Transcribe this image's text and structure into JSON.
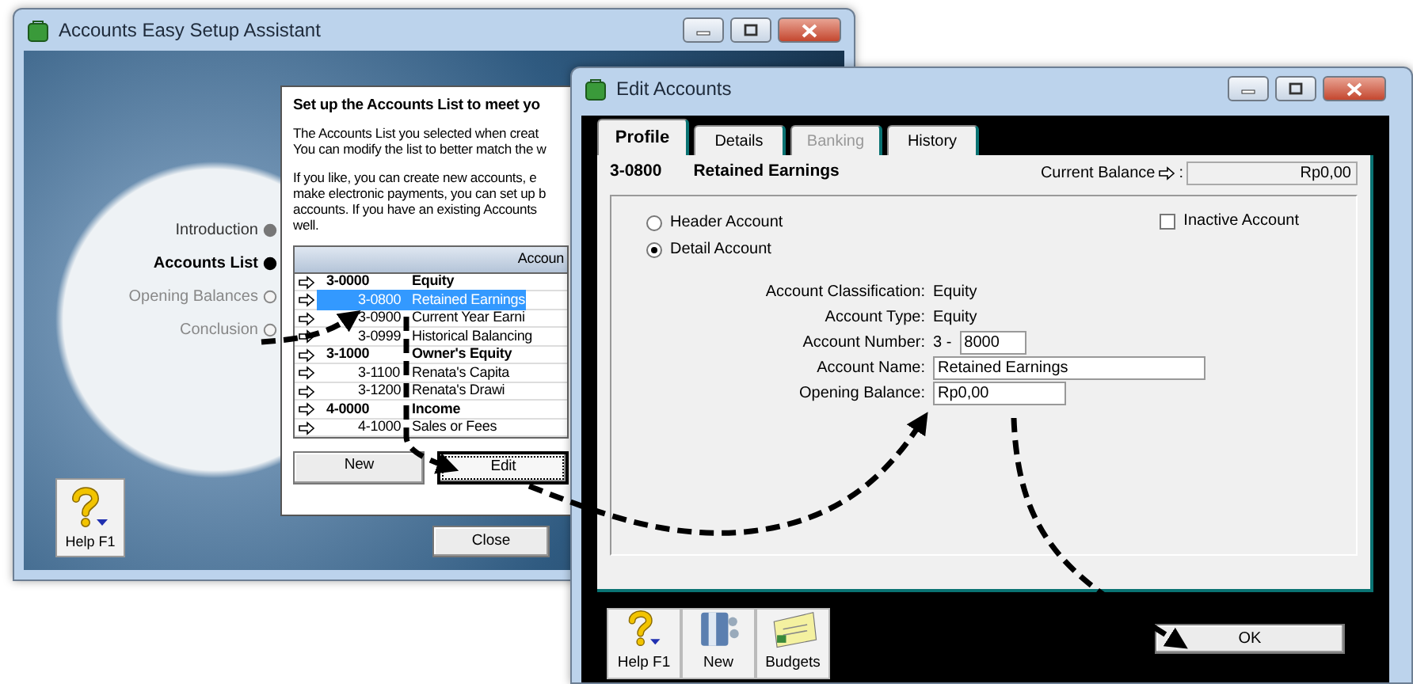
{
  "setup_window": {
    "title": "Accounts Easy Setup Assistant",
    "steps": [
      {
        "label": "Introduction",
        "selected": false,
        "done": true
      },
      {
        "label": "Accounts List",
        "selected": true
      },
      {
        "label": "Opening Balances",
        "selected": false,
        "done": false
      },
      {
        "label": "Conclusion",
        "selected": false,
        "done": false
      }
    ],
    "dialog": {
      "heading": "Set up the Accounts List to meet yo",
      "paragraphs": [
        [
          "The Accounts List you selected when creat",
          "You can modify the list to better match the w"
        ],
        [
          "If you like, you can create new accounts, e",
          "make electronic payments, you can set up b",
          "accounts. If you have an existing Accounts",
          "well."
        ]
      ],
      "table": {
        "columns": [
          "Accoun"
        ],
        "rows": [
          {
            "number": "3-0000",
            "name": "Equity",
            "kind": "header",
            "selected": false
          },
          {
            "number": "3-0800",
            "name": "Retained Earnings",
            "kind": "detail",
            "selected": true
          },
          {
            "number": "3-0900",
            "name": "Current Year Earni",
            "kind": "detail",
            "selected": false
          },
          {
            "number": "3-0999",
            "name": "Historical Balancing",
            "kind": "detail",
            "selected": false
          },
          {
            "number": "3-1000",
            "name": "Owner's Equity",
            "kind": "header",
            "selected": false
          },
          {
            "number": "3-1100",
            "name": "Renata's Capita",
            "kind": "detail",
            "selected": false
          },
          {
            "number": "3-1200",
            "name": "Renata's Drawi",
            "kind": "detail",
            "selected": false
          },
          {
            "number": "4-0000",
            "name": "Income",
            "kind": "header",
            "selected": false
          },
          {
            "number": "4-1000",
            "name": "Sales or Fees",
            "kind": "detail",
            "selected": false
          }
        ]
      },
      "buttons": [
        {
          "label": "New",
          "focused": false
        },
        {
          "label": "Edit",
          "focused": true
        }
      ]
    },
    "help_button": {
      "label": "Help F1"
    },
    "close_button": {
      "label": "Close"
    }
  },
  "edit_window": {
    "title": "Edit Accounts",
    "tabs": [
      {
        "label": "Profile",
        "selected": true,
        "disabled": false
      },
      {
        "label": "Details",
        "selected": false,
        "disabled": false
      },
      {
        "label": "Banking",
        "selected": false,
        "disabled": true
      },
      {
        "label": "History",
        "selected": false,
        "disabled": false
      }
    ],
    "account": {
      "number": "3-0800",
      "name": "Retained Earnings"
    },
    "current_balance": {
      "label": "Current Balance",
      "suffix": ":",
      "value": "Rp0,00"
    },
    "account_kinds": [
      {
        "label": "Header Account",
        "checked": false
      },
      {
        "label": "Detail Account",
        "checked": true
      }
    ],
    "inactive": {
      "label": "Inactive Account",
      "checked": false
    },
    "fields": [
      {
        "label": "Account Classification:",
        "kind": "text",
        "value": "Equity"
      },
      {
        "label": "Account Type:",
        "kind": "text",
        "value": "Equity"
      },
      {
        "label": "Account Number:",
        "kind": "prefixed",
        "prefix": "3 -",
        "value": "8000"
      },
      {
        "label": "Account Name:",
        "kind": "name",
        "value": "Retained Earnings"
      },
      {
        "label": "Opening Balance:",
        "kind": "amount",
        "value": "Rp0,00"
      }
    ],
    "toolbar": [
      {
        "label": "Help F1",
        "kind": "help"
      },
      {
        "label": "New",
        "kind": "new"
      },
      {
        "label": "Budgets",
        "kind": "budgets"
      }
    ],
    "ok_button": {
      "label": "OK"
    }
  }
}
